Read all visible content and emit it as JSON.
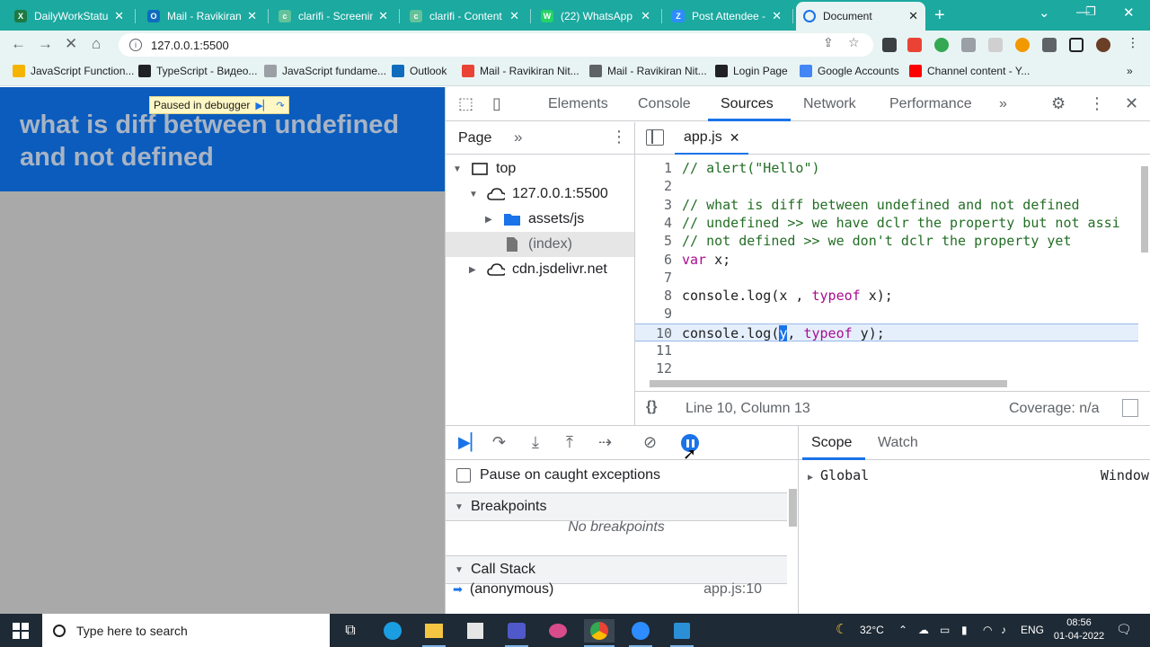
{
  "browser": {
    "tabs": [
      {
        "title": "DailyWorkStatus",
        "icon_color": "#1d7a44",
        "icon_letter": "X"
      },
      {
        "title": "Mail - Ravikiran",
        "icon_color": "#0f6cbd",
        "icon_letter": "O"
      },
      {
        "title": "clarifi - Screenin",
        "icon_color": "#63c29a",
        "icon_letter": "c"
      },
      {
        "title": "clarifi - Content",
        "icon_color": "#63c29a",
        "icon_letter": "c"
      },
      {
        "title": "(22) WhatsApp",
        "icon_color": "#25d366",
        "icon_letter": "W"
      },
      {
        "title": "Post Attendee -",
        "icon_color": "#2d8cff",
        "icon_letter": "Z"
      },
      {
        "title": "Document",
        "icon_color": "#1a73e8",
        "icon_letter": ""
      }
    ],
    "new_tab_label": "+",
    "url": "127.0.0.1:5500",
    "bookmarks": [
      {
        "label": "JavaScript Function...",
        "color": "#f4b400"
      },
      {
        "label": "TypeScript - Видео...",
        "color": "#202124"
      },
      {
        "label": "JavaScript fundame...",
        "color": "#9aa0a6"
      },
      {
        "label": "Outlook",
        "color": "#0f6cbd"
      },
      {
        "label": "Mail - Ravikiran Nit...",
        "color": "#ea4335"
      },
      {
        "label": "Mail - Ravikiran Nit...",
        "color": "#5f6368"
      },
      {
        "label": "Login Page",
        "color": "#202124"
      },
      {
        "label": "Google Accounts",
        "color": "#4285f4"
      },
      {
        "label": "Channel content - Y...",
        "color": "#ff0000"
      }
    ],
    "bookmarks_more": "»"
  },
  "page": {
    "heading": "what is diff between undefined and not defined",
    "paused_badge": "Paused in debugger"
  },
  "devtools": {
    "tabs": [
      "Elements",
      "Console",
      "Sources",
      "Network",
      "Performance"
    ],
    "active_tab": "Sources",
    "more_tabs": "»",
    "navigator": {
      "tab": "Page",
      "more": "»",
      "tree": [
        {
          "label": "top",
          "level": 0,
          "expanded": true,
          "icon": "frame-icon"
        },
        {
          "label": "127.0.0.1:5500",
          "level": 1,
          "expanded": true,
          "icon": "cloud-icon"
        },
        {
          "label": "assets/js",
          "level": 2,
          "expanded": false,
          "icon": "folder-icon"
        },
        {
          "label": "(index)",
          "level": 2,
          "expanded": null,
          "icon": "file-icon",
          "selected": true
        },
        {
          "label": "cdn.jsdelivr.net",
          "level": 1,
          "expanded": false,
          "icon": "cloud-icon"
        }
      ]
    },
    "editor": {
      "file_tab": "app.js",
      "lines": [
        {
          "n": "1",
          "parts": [
            {
              "c": "cm",
              "t": "// alert(\"Hello\")"
            }
          ]
        },
        {
          "n": "2",
          "parts": []
        },
        {
          "n": "3",
          "parts": [
            {
              "c": "cm",
              "t": "// what is diff between undefined and not defined"
            }
          ]
        },
        {
          "n": "4",
          "parts": [
            {
              "c": "cm",
              "t": "// undefined >> we have dclr the property but not assi"
            }
          ]
        },
        {
          "n": "5",
          "parts": [
            {
              "c": "cm",
              "t": "// not defined >> we don't dclr the property yet"
            }
          ]
        },
        {
          "n": "6",
          "parts": [
            {
              "c": "kw",
              "t": "var"
            },
            {
              "c": "tx",
              "t": " x;"
            }
          ]
        },
        {
          "n": "7",
          "parts": []
        },
        {
          "n": "8",
          "parts": [
            {
              "c": "tx",
              "t": "console.log(x , "
            },
            {
              "c": "kw",
              "t": "typeof"
            },
            {
              "c": "tx",
              "t": " x);"
            }
          ]
        },
        {
          "n": "9",
          "parts": []
        },
        {
          "n": "10",
          "highlight": true,
          "parts": [
            {
              "c": "tx",
              "t": "console.log("
            },
            {
              "c": "cursor-sel",
              "t": "y"
            },
            {
              "c": "tx",
              "t": ", "
            },
            {
              "c": "kw",
              "t": "typeof"
            },
            {
              "c": "tx",
              "t": " y);"
            }
          ]
        },
        {
          "n": "11",
          "parts": []
        },
        {
          "n": "12",
          "parts": []
        }
      ],
      "status_position": "Line 10, Column 13",
      "coverage": "Coverage: n/a",
      "braces": "{}"
    },
    "debugger": {
      "pause_on_caught": "Pause on caught exceptions",
      "breakpoints_title": "Breakpoints",
      "no_breakpoints": "No breakpoints",
      "call_stack_title": "Call Stack",
      "call_stack": [
        {
          "fn": "(anonymous)",
          "loc": "app.js:10"
        }
      ],
      "scope_tabs": [
        "Scope",
        "Watch"
      ],
      "global_label": "Global",
      "global_value": "Window"
    }
  },
  "taskbar": {
    "search_placeholder": "Type here to search",
    "weather": "32°C",
    "lang": "ENG",
    "time": "08:56",
    "date": "01-04-2022"
  }
}
